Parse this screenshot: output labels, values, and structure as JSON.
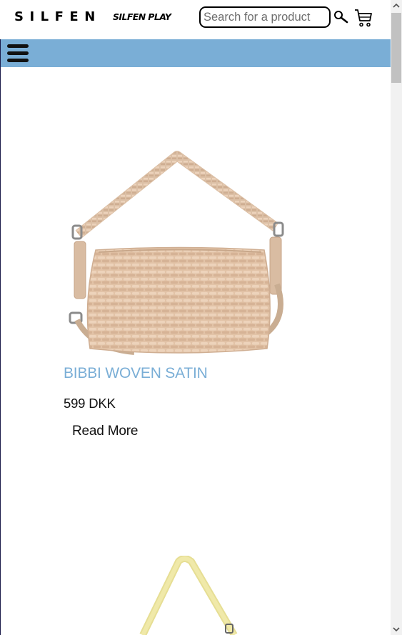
{
  "header": {
    "logo": "SILFEN",
    "secondary_logo": "SILFEN PLAY",
    "search": {
      "placeholder": "Search for a product",
      "value": ""
    },
    "icons": [
      "search-icon",
      "cart-icon"
    ]
  },
  "nav": {
    "menu_icon": "hamburger-menu-icon"
  },
  "products": [
    {
      "name": "BIBBI WOVEN SATIN",
      "price": "599 DKK",
      "cta": "Read More",
      "image": "beige-woven-shoulder-bag"
    },
    {
      "image": "yellow-shoulder-bag"
    }
  ],
  "colors": {
    "nav_bar": "#7aaed6",
    "product_name": "#7aaed6"
  }
}
